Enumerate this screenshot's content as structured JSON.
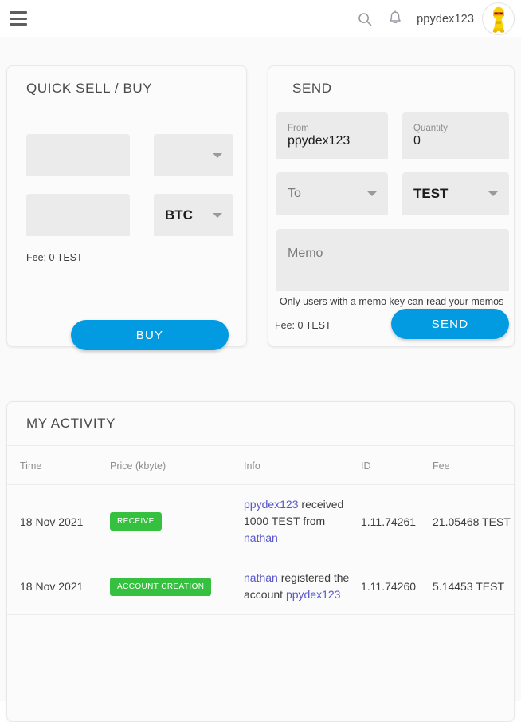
{
  "topbar": {
    "menu_icon": "hamburger-menu-icon",
    "search_icon": "search-icon",
    "notifications_icon": "bell-icon",
    "username": "ppydex123",
    "avatar_icon": "user-avatar-icon"
  },
  "quick_trade": {
    "title": "QUICK SELL / BUY",
    "amount_value": "",
    "amount_placeholder": "",
    "asset_value": "",
    "asset_placeholder": "",
    "total_value": "",
    "total_placeholder": "",
    "pair_value": "BTC",
    "fee": "Fee: 0 TEST",
    "submit_label": "BUY"
  },
  "send": {
    "title": "SEND",
    "from_label": "From",
    "from_value": "ppydex123",
    "quantity_label": "Quantity",
    "quantity_value": "0",
    "to_placeholder": "To",
    "asset_value": "TEST",
    "memo_placeholder": "Memo",
    "memo_hint": "Only users with a memo key can read your memos",
    "fee": "Fee: 0 TEST",
    "submit_label": "SEND"
  },
  "activity": {
    "title": "MY ACTIVITY",
    "columns": [
      "Time",
      "Price (kbyte)",
      "Info",
      "ID",
      "Fee"
    ],
    "rows": [
      {
        "time": "18 Nov 2021",
        "badge": "RECEIVE",
        "badge_color": "#35c13f",
        "info": [
          {
            "text": "ppydex123",
            "link": true
          },
          {
            "text": "received",
            "link": false
          },
          {
            "text": "1000 TEST",
            "link": false
          },
          {
            "text": "from",
            "link": false
          },
          {
            "text": "nathan",
            "link": true
          }
        ],
        "id": "1.11.74261",
        "fee": "21.05468 TEST"
      },
      {
        "time": "18 Nov 2021",
        "badge": "ACCOUNT CREATION",
        "badge_color": "#35c13f",
        "info": [
          {
            "text": "nathan",
            "link": true
          },
          {
            "text": "registered",
            "link": false
          },
          {
            "text": "the",
            "link": false
          },
          {
            "text": "account",
            "link": false
          },
          {
            "text": "ppydex123",
            "link": true
          }
        ],
        "id": "1.11.74260",
        "fee": "5.14453 TEST"
      }
    ]
  },
  "colors": {
    "accent_blue": "#029ae0",
    "badge_green": "#35c13f",
    "link_blue": "#5555cc",
    "field_grey": "#ebebec",
    "page_bg": "#fafafa"
  }
}
